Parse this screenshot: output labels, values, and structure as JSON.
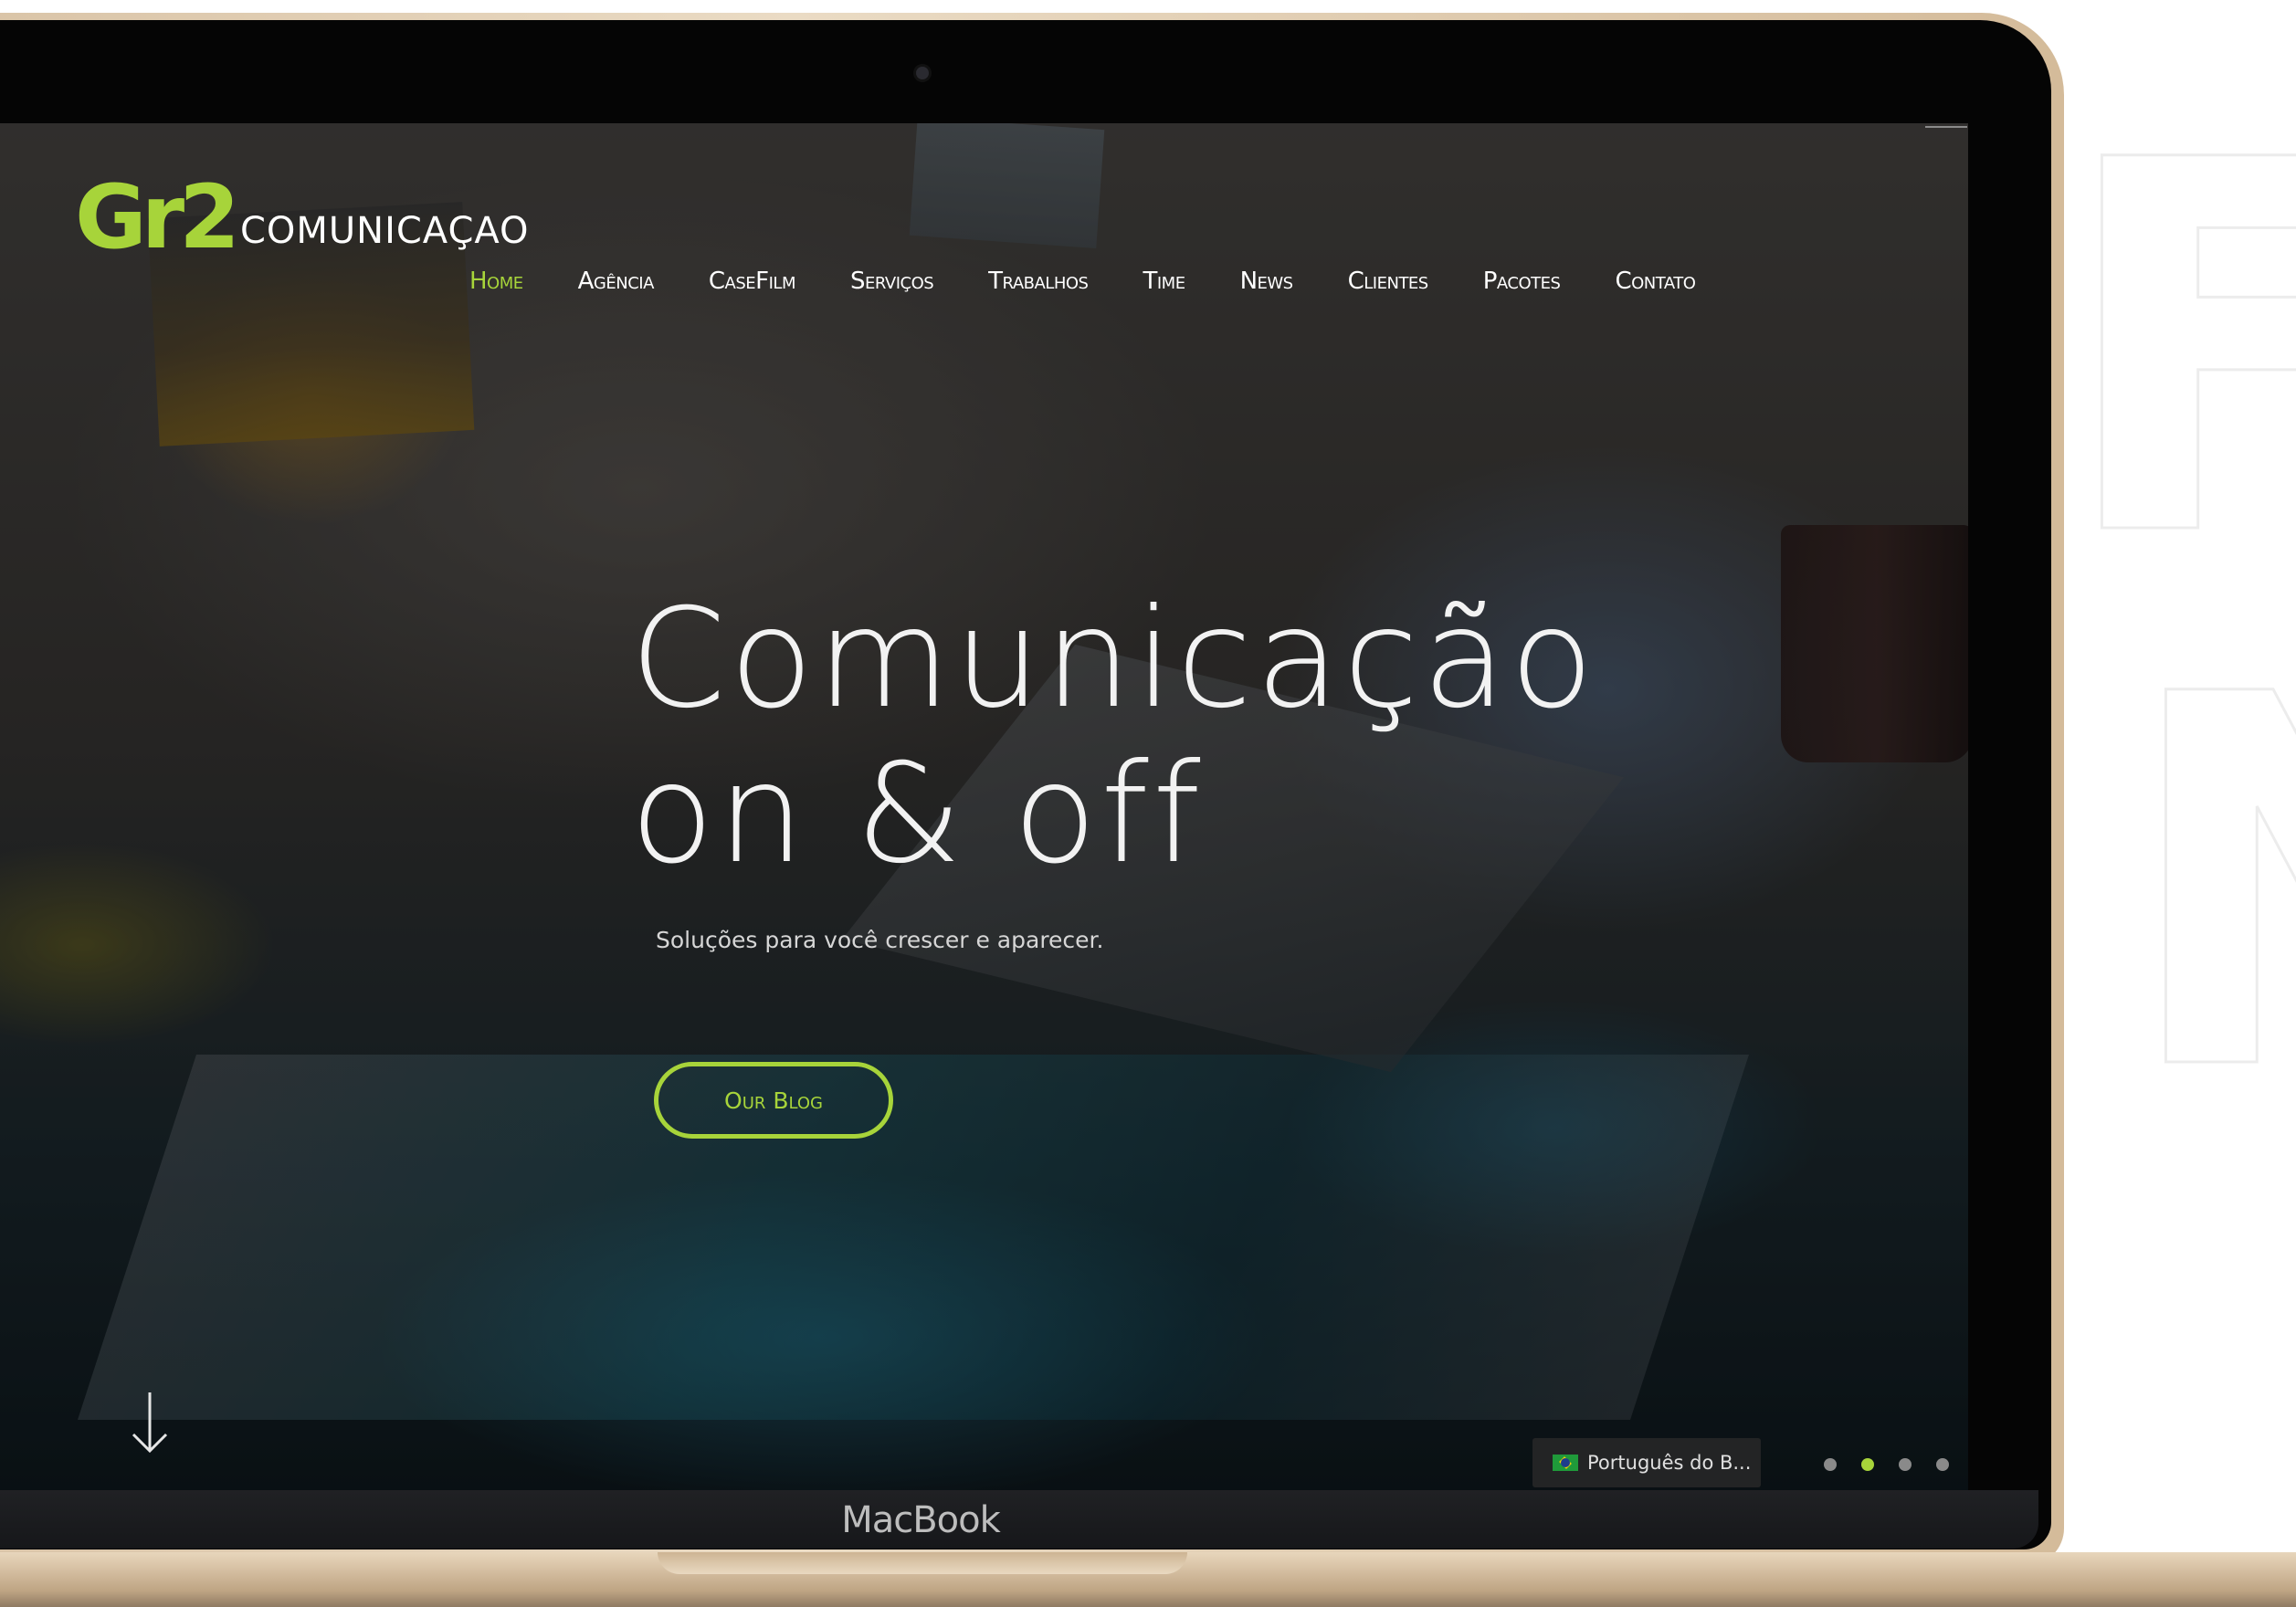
{
  "device": {
    "label": "MacBook"
  },
  "site": {
    "logo": {
      "mark": "Gr2",
      "word": "COMUNICAÇAO"
    },
    "nav": [
      {
        "label": "Home",
        "active": true
      },
      {
        "label": "Agência",
        "active": false
      },
      {
        "label": "CaseFilm",
        "active": false
      },
      {
        "label": "Serviços",
        "active": false
      },
      {
        "label": "Trabalhos",
        "active": false
      },
      {
        "label": "Time",
        "active": false
      },
      {
        "label": "News",
        "active": false
      },
      {
        "label": "Clientes",
        "active": false
      },
      {
        "label": "Pacotes",
        "active": false
      },
      {
        "label": "Contato",
        "active": false
      }
    ],
    "hero": {
      "title_line1": "Comunicação",
      "title_line2": "on & off",
      "subtitle": "Soluções para você crescer e aparecer.",
      "cta_label": "Our Blog"
    },
    "language": {
      "label": "Português do B..."
    },
    "slider": {
      "total": 4,
      "active_index": 1
    }
  },
  "background_letters": [
    "F",
    "N"
  ],
  "colors": {
    "accent": "#a7d43a",
    "text": "#ffffff",
    "laptop_gold": "#e0cdb1"
  }
}
